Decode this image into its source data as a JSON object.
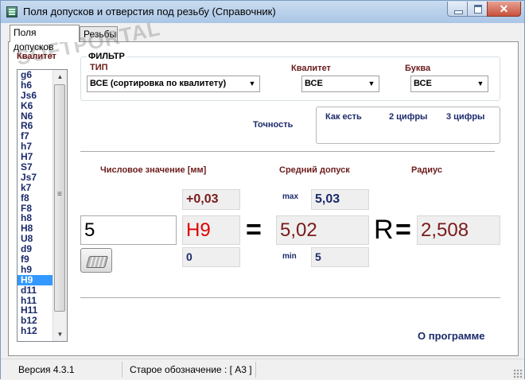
{
  "window": {
    "title": "Поля допусков и отверстия под резьбу (Справочник)",
    "close_glyph": "✕"
  },
  "tabs": [
    {
      "label": "Поля допусков",
      "active": true
    },
    {
      "label": "Резьбы",
      "active": false
    }
  ],
  "watermark": "SOFTPORTAL",
  "kvalitet_list": {
    "label": "Квалитет",
    "items": [
      "g6",
      "h6",
      "Js6",
      "K6",
      "N6",
      "R6",
      "f7",
      "h7",
      "H7",
      "S7",
      "Js7",
      "k7",
      "f8",
      "F8",
      "h8",
      "H8",
      "U8",
      "d9",
      "f9",
      "h9",
      "H9",
      "d11",
      "h11",
      "H11",
      "b12",
      "h12"
    ],
    "selected": "H9"
  },
  "filter": {
    "title": "ФИЛЬТР",
    "type_label": "ТИП",
    "type_value": "ВСЕ (сортировка по квалитету)",
    "kvalitet_label": "Квалитет",
    "kvalitet_value": "ВСЕ",
    "letter_label": "Буква",
    "letter_value": "ВСЕ"
  },
  "precision": {
    "label": "Точность",
    "options": [
      "Как есть",
      "2 цифры",
      "3 цифры"
    ]
  },
  "calc": {
    "numeric_label": "Числовое значение [мм]",
    "mid_label": "Средний допуск",
    "radius_label": "Радиус",
    "upper_dev": "+0,03",
    "lower_dev": "0",
    "input_value": "5",
    "tolerance": "H9",
    "equals": "=",
    "max_label": "max",
    "max_value": "5,03",
    "mid_value": "5,02",
    "min_label": "min",
    "min_value": "5",
    "r_symbol": "R",
    "radius_value": "2,508"
  },
  "about_link": "О программе",
  "status": {
    "version": "Версия 4.3.1",
    "old_designation": "Старое обозначение :  [ А3 ]"
  },
  "colors": {
    "accent": "#6b1b1b",
    "navy": "#1b2a6b",
    "red": "#e00000",
    "selection": "#3399ff"
  }
}
